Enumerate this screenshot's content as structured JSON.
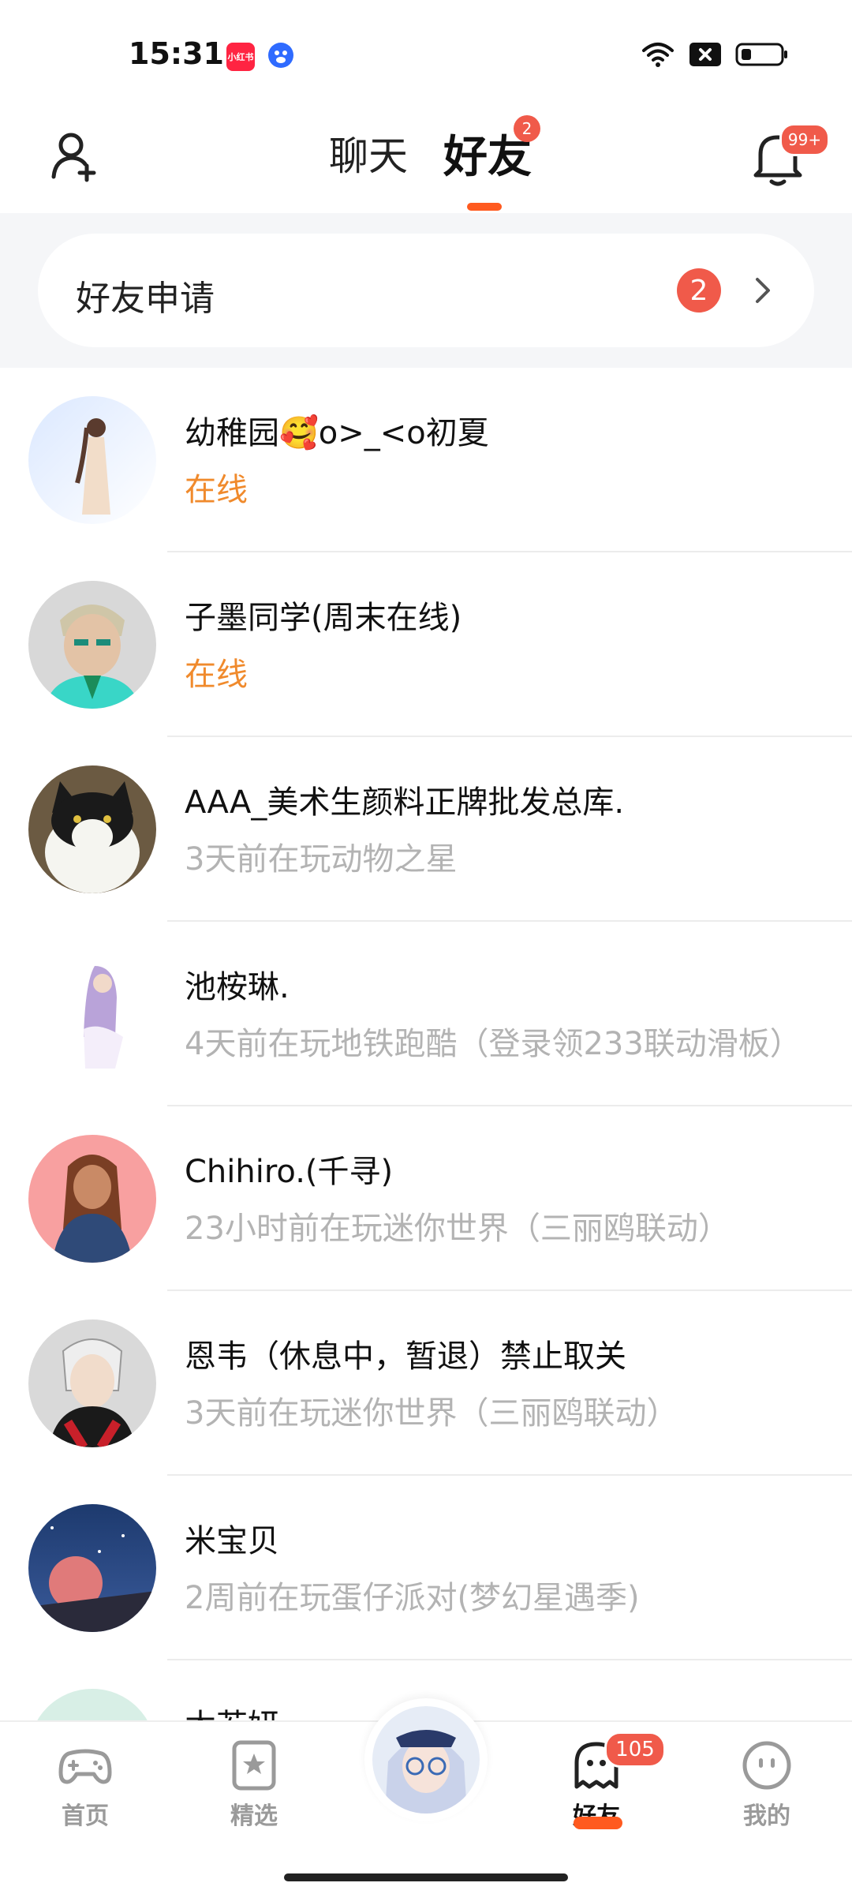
{
  "status_bar": {
    "time": "15:31",
    "app_icons": [
      "xiaohongshu-icon",
      "baidu-icon"
    ],
    "app1_text": "小红书",
    "right_icons": [
      "wifi-icon",
      "close-box-icon",
      "battery-icon"
    ]
  },
  "header": {
    "tabs": [
      {
        "label": "聊天",
        "active": false
      },
      {
        "label": "好友",
        "active": true,
        "badge": "2"
      }
    ],
    "notification_badge": "99+",
    "accent": "#ff5a1f"
  },
  "friend_request": {
    "label": "好友申请",
    "count": "2"
  },
  "friends": [
    {
      "name": "幼稚园🥰o>_<o初夏",
      "status": "在线",
      "online": true
    },
    {
      "name": "子墨同学(周末在线)",
      "status": "在线",
      "online": true
    },
    {
      "name": "AAA_美术生颜料正牌批发总库.",
      "status": "3天前在玩动物之星",
      "online": false
    },
    {
      "name": "池桉琳.",
      "status": "4天前在玩地铁跑酷（登录领233联动滑板）",
      "online": false
    },
    {
      "name": "Chihiro.(千寻)",
      "status": "23小时前在玩迷你世界（三丽鸥联动）",
      "online": false
    },
    {
      "name": "恩韦（休息中，暂退）禁止取关",
      "status": "3天前在玩迷你世界（三丽鸥联动）",
      "online": false
    },
    {
      "name": "米宝贝",
      "status": "2周前在玩蛋仔派对(梦幻星遇季)",
      "online": false
    },
    {
      "name": "木若妍",
      "status": "",
      "online": false
    }
  ],
  "bottom_nav": {
    "items": [
      {
        "label": "首页",
        "icon": "gamepad-icon",
        "active": false
      },
      {
        "label": "精选",
        "icon": "star-bookmark-icon",
        "active": false
      },
      {
        "label": "",
        "icon": "center-avatar",
        "active": false
      },
      {
        "label": "好友",
        "icon": "ghost-icon",
        "active": true,
        "badge": "105"
      },
      {
        "label": "我的",
        "icon": "face-icon",
        "active": false
      }
    ]
  }
}
